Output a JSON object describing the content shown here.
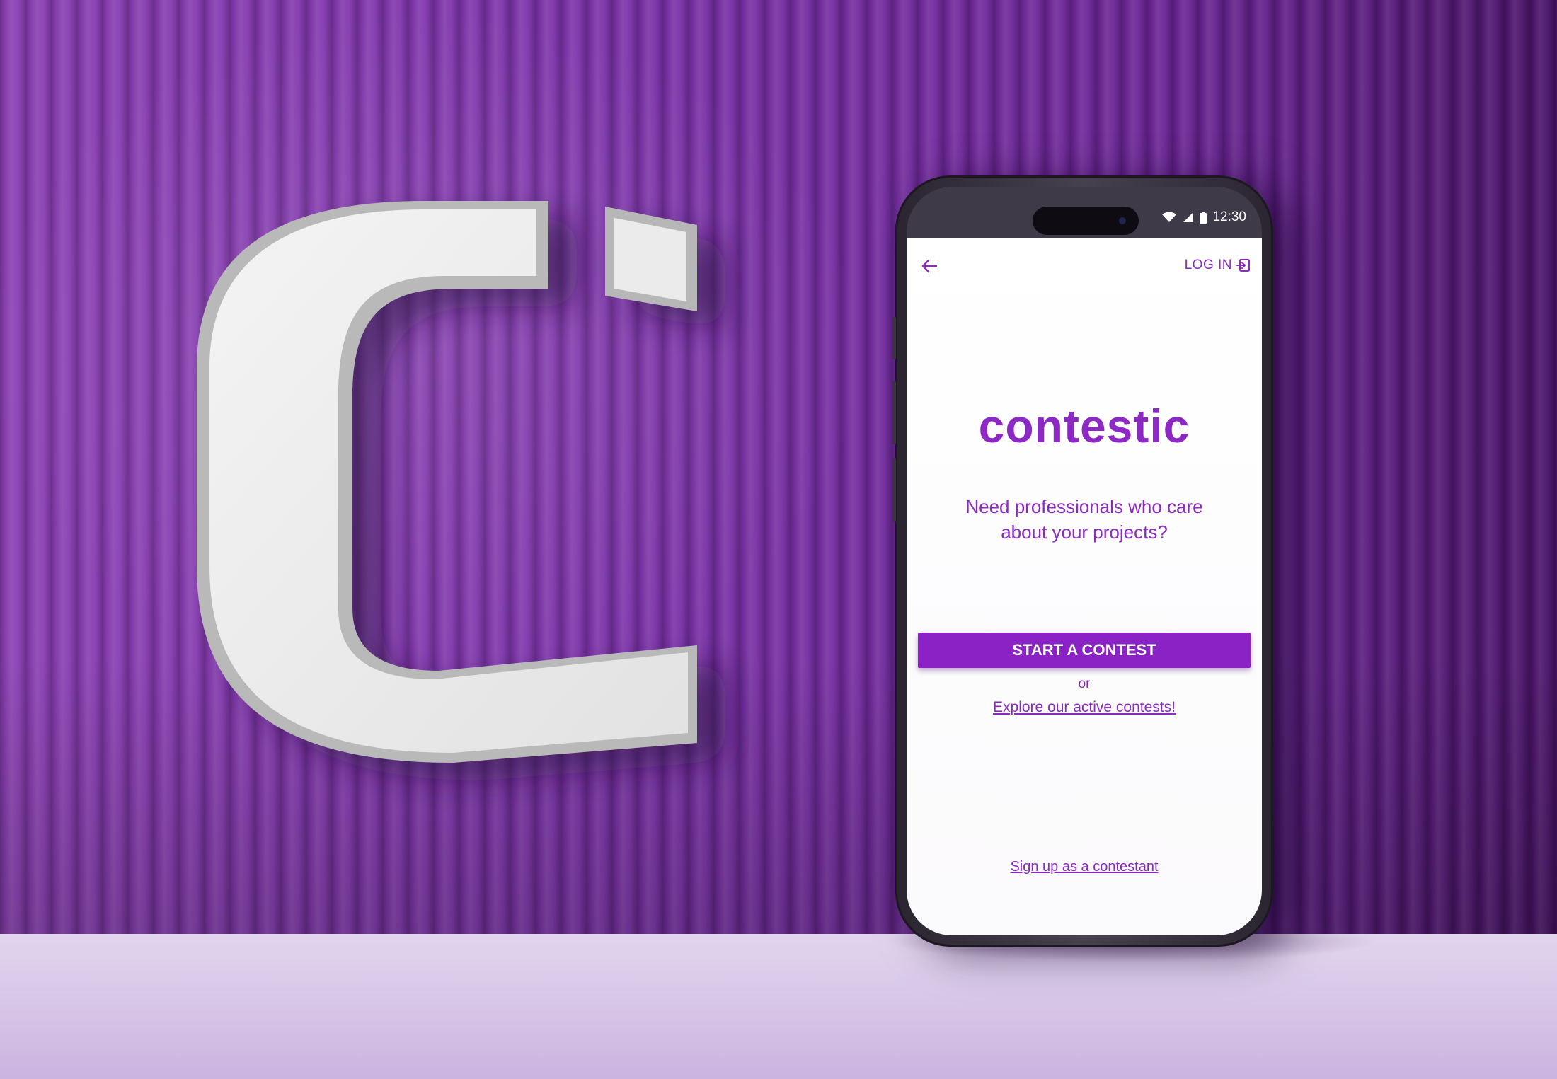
{
  "status_bar": {
    "time": "12:30",
    "icons": [
      "wifi-icon",
      "cellular-signal-icon",
      "battery-icon"
    ]
  },
  "header": {
    "back_icon": "arrow-left-icon",
    "login_label": "LOG IN",
    "login_icon": "login-arrow-icon"
  },
  "brand": {
    "name": "contestic"
  },
  "tagline": "Need professionals who care about your projects?",
  "cta": {
    "label": "START A CONTEST"
  },
  "separator": "or",
  "explore_link": "Explore our active contests!",
  "signup_link": "Sign up as a contestant",
  "colors": {
    "brand_purple": "#8b22c6",
    "wall_purple": "#7b32a8",
    "floor_lilac": "#ddcdea",
    "logo_white": "#ececec"
  }
}
